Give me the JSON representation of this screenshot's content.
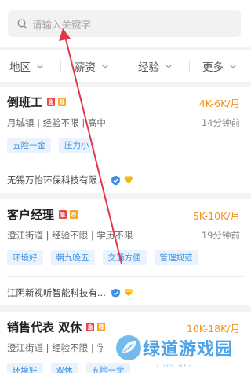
{
  "search": {
    "placeholder": "请输入关键字",
    "icon": "search-icon"
  },
  "filters": [
    {
      "label": "地区"
    },
    {
      "label": "薪资"
    },
    {
      "label": "经验"
    },
    {
      "label": "更多"
    }
  ],
  "jobs": [
    {
      "title": "倒班工",
      "salary": "4K-6K/月",
      "meta": "月城镇 | 经验不限 | 高中",
      "time": "14分钟前",
      "tags": [
        "五险一金",
        "压力小"
      ],
      "company": "无锡万怡环保科技有限..."
    },
    {
      "title": "客户经理",
      "salary": "5K-10K/月",
      "meta": "澄江街道 | 经验不限 | 学历不限",
      "time": "19分钟前",
      "tags": [
        "环境好",
        "朝九晚五",
        "交通方便",
        "管理规范"
      ],
      "company": "江阴新视听智能科技有..."
    },
    {
      "title": "销售代表 双休",
      "salary": "10K-18K/月",
      "meta": "澄江街道 | 经验不限 | 学历不限",
      "time": "",
      "tags": [
        "环境好",
        "双休",
        "五险一金"
      ],
      "company": ""
    }
  ],
  "badges": {
    "red": "急",
    "gold": "荐"
  },
  "watermark": {
    "text": "绿道游戏园",
    "sub": "LDYG.NET"
  },
  "colors": {
    "salary": "#f5911e",
    "tag_text": "#3a8ee6",
    "tag_bg": "#eaf3fc",
    "arrow": "#e0384b"
  }
}
